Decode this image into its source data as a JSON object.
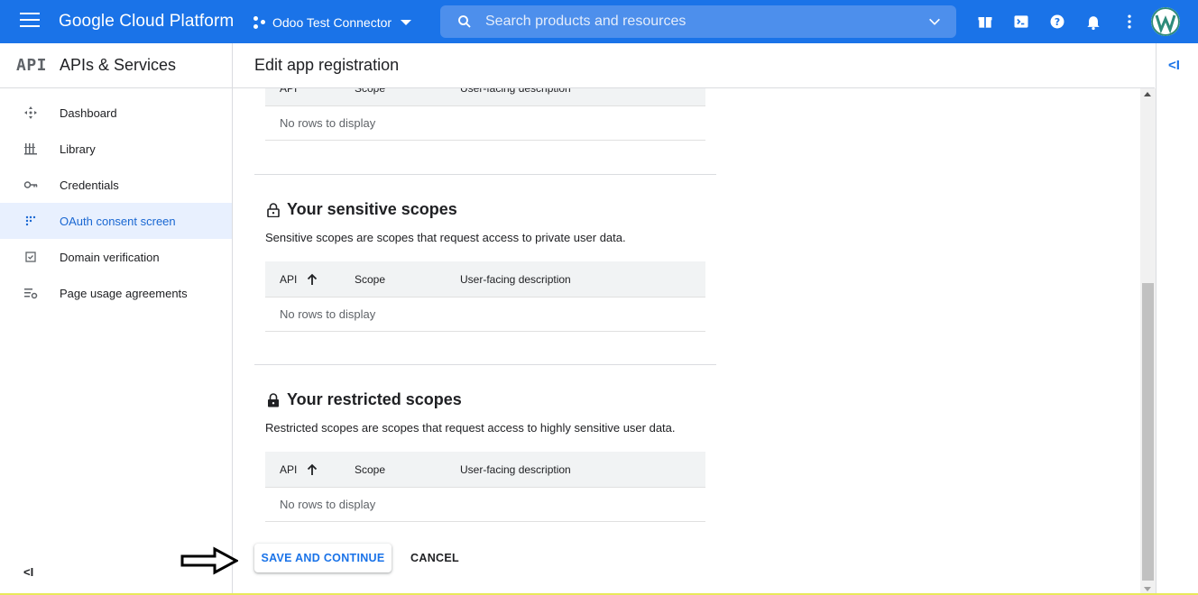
{
  "topbar": {
    "brand": "Google Cloud Platform",
    "project": "Odoo Test Connector",
    "search_placeholder": "Search products and resources"
  },
  "sidebar": {
    "logo": "API",
    "title": "APIs & Services",
    "items": [
      {
        "label": "Dashboard",
        "icon": "dashboard-icon"
      },
      {
        "label": "Library",
        "icon": "library-icon"
      },
      {
        "label": "Credentials",
        "icon": "key-icon"
      },
      {
        "label": "OAuth consent screen",
        "icon": "oauth-icon",
        "active": true
      },
      {
        "label": "Domain verification",
        "icon": "checkbox-icon"
      },
      {
        "label": "Page usage agreements",
        "icon": "settings-list-icon"
      }
    ],
    "collapse": "<I"
  },
  "page": {
    "title": "Edit app registration"
  },
  "table_columns": {
    "api": "API",
    "scope": "Scope",
    "description": "User-facing description"
  },
  "empty_text": "No rows to display",
  "sections": {
    "sensitive": {
      "title": "Your sensitive scopes",
      "description": "Sensitive scopes are scopes that request access to private user data."
    },
    "restricted": {
      "title": "Your restricted scopes",
      "description": "Restricted scopes are scopes that request access to highly sensitive user data."
    }
  },
  "actions": {
    "save": "SAVE AND CONTINUE",
    "cancel": "CANCEL"
  },
  "right_panel": {
    "expand": "<I"
  },
  "colors": {
    "accent": "#1a73e8",
    "active_bg": "#e8f0fe"
  }
}
